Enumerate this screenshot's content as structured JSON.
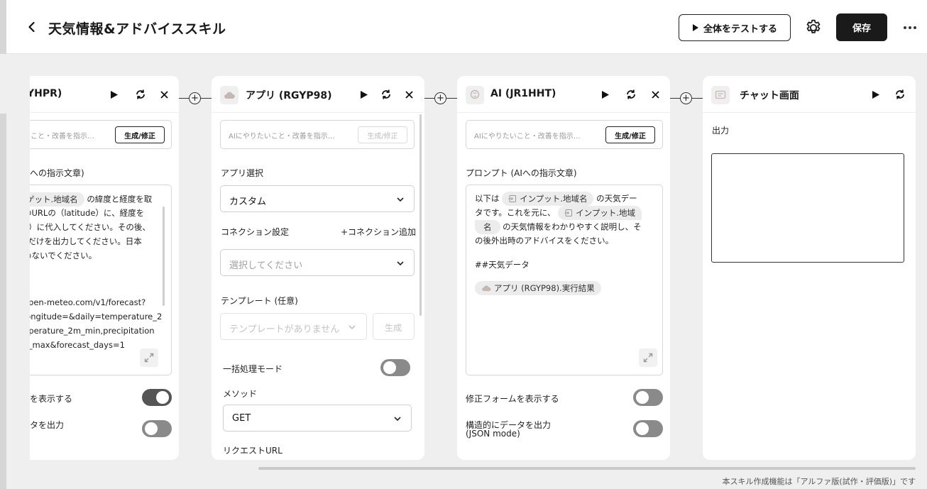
{
  "header": {
    "title": "天気情報&アドバイススキル",
    "test_all_label": "全体をテストする",
    "save_label": "保存"
  },
  "node_api_left": {
    "title": "YHPR)",
    "instruction_placeholder": "こと・改善を指示…",
    "generate_label": "生成/修正",
    "prompt_label": "への指示文章)",
    "prompt_chip": "ゲット.地域名",
    "prompt_lines": [
      "の緯度と経度を取",
      "のURLの（latitude）に、経度を",
      "e）に代入してください。その後、",
      "Lだけを出力してください。日本",
      "めないでください。",
      "open-meteo.com/v1/forecast?",
      "longitude=&daily=temperature_2",
      "nperature_2m_min,precipitation",
      "y_max&forecast_days=1"
    ],
    "show_form_label": "を表示する",
    "structured_label": "タを出力"
  },
  "node_app": {
    "title": "アプリ (RGYP98)",
    "instruction_placeholder": "AIにやりたいこと・改善を指示…",
    "generate_label": "生成/修正",
    "app_select_label": "アプリ選択",
    "app_select_value": "カスタム",
    "connection_label": "コネクション設定",
    "add_connection_label": "+コネクション追加",
    "connection_placeholder": "選択してください",
    "template_label": "テンプレート (任意)",
    "template_placeholder": "テンプレートがありません",
    "template_generate_label": "生成",
    "batch_mode_label": "一括処理モード",
    "method_label": "メソッド",
    "method_value": "GET",
    "request_url_label": "リクエストURL"
  },
  "node_ai": {
    "title": "AI (JR1HHT)",
    "instruction_placeholder": "AIにやりたいこと・改善を指示…",
    "generate_label": "生成/修正",
    "prompt_label": "プロンプト (AIへの指示文章)",
    "text_prefix": "以下は",
    "chip_input_region": "インプット.地域名",
    "text_weather_data": "の天気デー",
    "text_line2_a": "タです。これを元に、",
    "chip_input_region_a": "インプット.地域",
    "chip_input_region_b": "名",
    "text_line3": "の天気情報をわかりやすく説明し、そ",
    "text_line4": "の後外出時のアドバイスをください。",
    "text_heading": "##天気データ",
    "chip_app_result": "アプリ (RGYP98).実行結果",
    "show_form_label": "修正フォームを表示する",
    "structured_label_1": "構造的にデータを出力",
    "structured_label_2": "(JSON mode)"
  },
  "node_chat": {
    "title": "チャット画面",
    "output_label": "出力"
  },
  "footer": {
    "note": "本スキル作成機能は「アルファ版(試作・評価版)」です"
  },
  "toggles": {
    "left_show_form": true,
    "left_structured": false,
    "app_batch_mode": false,
    "ai_show_form": false,
    "ai_structured": false
  },
  "icons": [
    "chevron-left-icon",
    "play-icon",
    "gear-icon",
    "more-horizontal-icon",
    "refresh-icon",
    "close-icon",
    "cloud-icon",
    "brain-icon",
    "chat-icon",
    "chevron-down-icon",
    "expand-icon",
    "input-icon",
    "plus-icon"
  ]
}
